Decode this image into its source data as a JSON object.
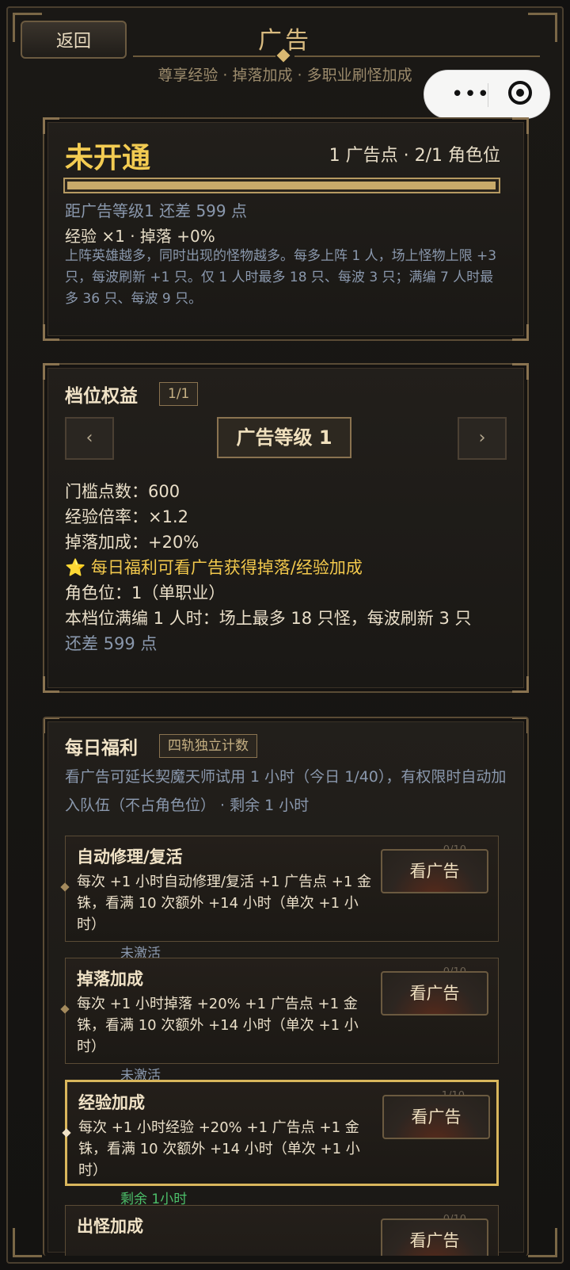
{
  "header": {
    "back_label": "返回",
    "title": "广告",
    "subtitle": "尊享经验 · 掉落加成 · 多职业刷怪加成"
  },
  "status": {
    "title": "未开通",
    "meta": "1 广告点 · 2/1 角色位",
    "progress_fraction": 0.998,
    "remaining": "距广告等级1 还差 599 点",
    "bonus": "经验 ×1  ·  掉落 +0%",
    "description": "上阵英雄越多，同时出现的怪物越多。每多上阵 1 人，场上怪物上限 +3 只，每波刷新 +1 只。仅 1 人时最多 18 只、每波 3 只；满编 7 人时最多 36 只、每波 9 只。"
  },
  "tier": {
    "title": "档位权益",
    "page_tag": "1/1",
    "prev_label": "‹",
    "next_label": "›",
    "level_label": "广告等级 1",
    "threshold": "门槛点数：600",
    "exp_rate": "经验倍率：×1.2",
    "drop_bonus": "掉落加成：+20%",
    "daily_note": "⭐ 每日福利可看广告获得掉落/经验加成",
    "role_slots": "角色位：1（单职业）",
    "full_team": "本档位满编 1 人时：场上最多 18 只怪，每波刷新 3 只",
    "remaining": "还差 599 点"
  },
  "daily": {
    "title": "每日福利",
    "tag": "四轨独立计数",
    "description": "看广告可延长契魔天师试用 1 小时（今日 1/40），有权限时自动加入队伍（不占角色位） · 剩余 1 小时",
    "ad_button_label": "看广告",
    "cards": [
      {
        "title": "自动修理/复活",
        "desc": "每次 +1 小时自动修理/复活 +1 广告点 +1 金铢，看满 10 次额外 +14 小时（单次 +1 小时）",
        "count": "0/10",
        "status": "未激活"
      },
      {
        "title": "掉落加成",
        "desc": "每次 +1 小时掉落 +20% +1 广告点 +1 金铢，看满 10 次额外 +14 小时（单次 +1 小时）",
        "count": "0/10",
        "status": "未激活"
      },
      {
        "title": "经验加成",
        "desc": "每次 +1 小时经验 +20% +1 广告点 +1 金铢，看满 10 次额外 +14 小时（单次 +1 小时）",
        "count": "1/10",
        "status": "剩余 1小时"
      },
      {
        "title": "出怪加成",
        "count": "0/10"
      }
    ]
  },
  "colors": {
    "accent_gold": "#f3cc52",
    "active_border": "#d9b65c",
    "muted_blue": "#8a98ad",
    "active_green": "#4cc06a"
  }
}
